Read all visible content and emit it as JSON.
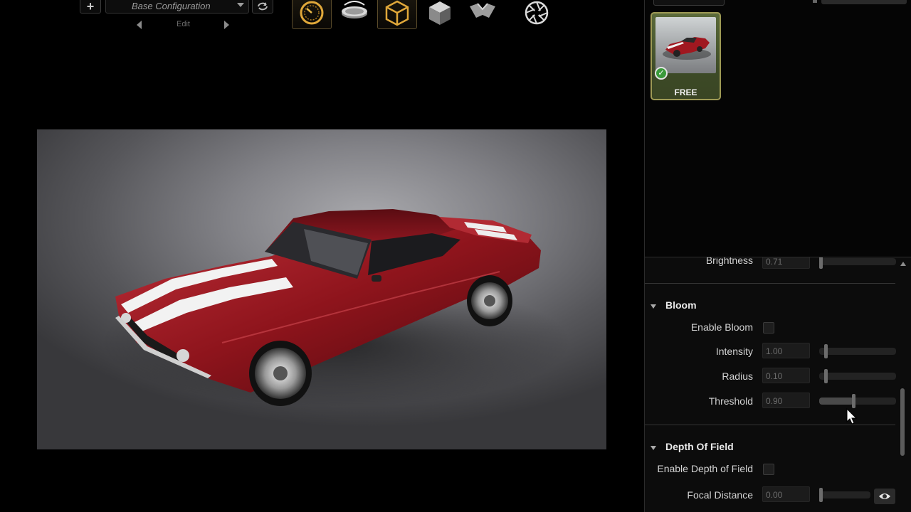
{
  "toolbar": {
    "add_label": "+",
    "config_select": "Base Configuration",
    "edit_label": "Edit",
    "tools": [
      {
        "name": "gauge-tool",
        "icon": "speedometer-icon",
        "active": true
      },
      {
        "name": "turntable-tool",
        "icon": "turntable-icon",
        "active": false
      },
      {
        "name": "wireframe-cube-tool",
        "icon": "cube-icon",
        "active": true
      },
      {
        "name": "solid-cube-tool",
        "icon": "solid-cube-icon",
        "active": false
      },
      {
        "name": "fold-tool",
        "icon": "fold-icon",
        "active": false
      },
      {
        "name": "camera-tool",
        "icon": "aperture-icon",
        "active": false
      }
    ]
  },
  "library": {
    "thumbnail_label": "FREE"
  },
  "properties": {
    "brightness": {
      "label": "Brightness",
      "value": "0.71"
    },
    "bloom": {
      "title": "Bloom",
      "enable_label": "Enable Bloom",
      "intensity": {
        "label": "Intensity",
        "value": "1.00",
        "level": 0.05
      },
      "radius": {
        "label": "Radius",
        "value": "0.10",
        "level": 0.05
      },
      "threshold": {
        "label": "Threshold",
        "value": "0.90",
        "level": 0.45
      }
    },
    "depth_of_field": {
      "title": "Depth Of Field",
      "enable_label": "Enable Depth of Field",
      "focal_distance": {
        "label": "Focal Distance",
        "value": "0.00",
        "level": 0.0
      }
    }
  },
  "colors": {
    "accent": "#e0a83a",
    "thumb_border": "#9e9a55",
    "car_red": "#a01820"
  }
}
